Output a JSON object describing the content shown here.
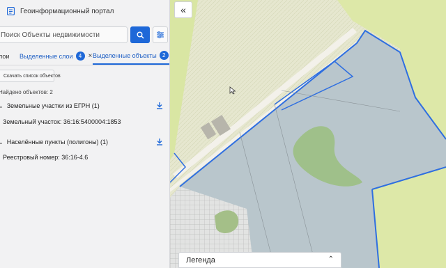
{
  "header": {
    "title": "Геоинформационный портал"
  },
  "search": {
    "placeholder": "Поиск Объекты недвижимости"
  },
  "tabs": [
    {
      "label": "лои"
    },
    {
      "label": "Выделенные слои",
      "count": "4"
    },
    {
      "label": "Выделенные объекты",
      "count": "2"
    }
  ],
  "actions": {
    "download_list": "Скачать список объектов"
  },
  "results": {
    "found": "Найдено объектов: 2",
    "groups": [
      {
        "title": "Земельные участки из ЕГРН (1)",
        "item": "Земельный участок: 36:16:5400004:1853"
      },
      {
        "title": "Населённые пункты (полигоны) (1)",
        "item": "Реестровый номер: 36:16-4.6"
      }
    ]
  },
  "legend": {
    "label": "Легенда"
  },
  "icons": {
    "logo": "portal-logo-icon",
    "search": "search-icon",
    "filter": "filter-sliders-icon",
    "collapse": "double-chevron-left-icon",
    "download": "download-icon",
    "close": "close-icon"
  },
  "colors": {
    "accent": "#1e68d8",
    "parcel_outline": "#2f6fe0"
  }
}
